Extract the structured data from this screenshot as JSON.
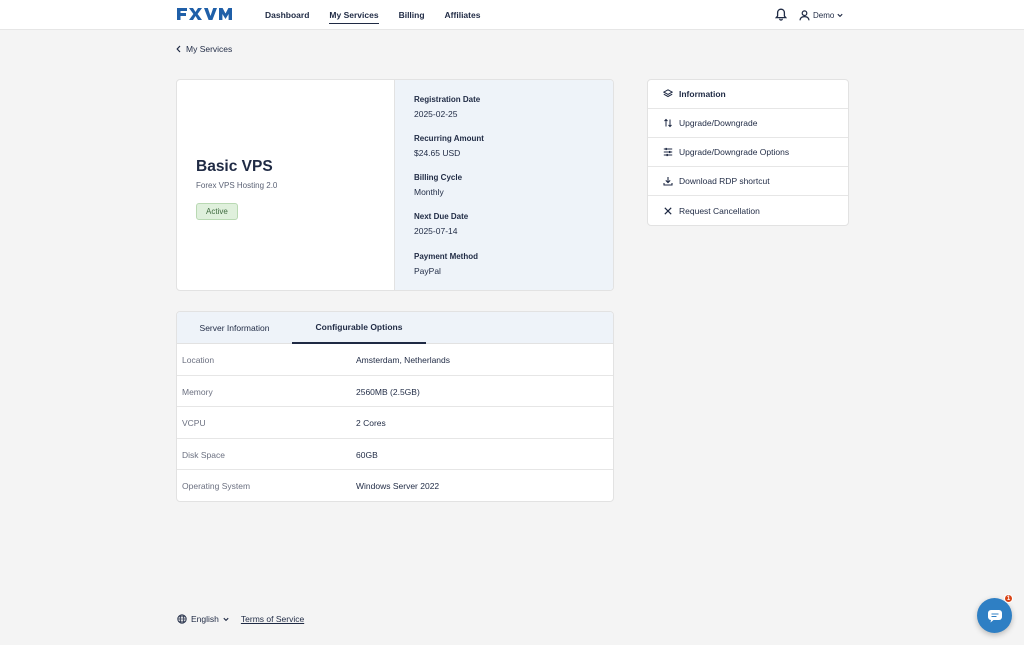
{
  "brand": {
    "logo_text": "FXVM",
    "logo_color": "#1f5fa8"
  },
  "nav": {
    "items": [
      {
        "label": "Dashboard",
        "active": false
      },
      {
        "label": "My Services",
        "active": true
      },
      {
        "label": "Billing",
        "active": false
      },
      {
        "label": "Affiliates",
        "active": false
      }
    ]
  },
  "header": {
    "notification_icon": "bell-icon",
    "user_icon": "user-icon",
    "user_name": "Demo"
  },
  "breadcrumb": {
    "back_label": "My Services"
  },
  "product": {
    "name": "Basic VPS",
    "group": "Forex VPS Hosting 2.0",
    "status": "Active",
    "status_color": "#dff0dc",
    "fields": [
      {
        "label": "Registration Date",
        "value": "2025-02-25"
      },
      {
        "label": "Recurring Amount",
        "value": "$24.65 USD"
      },
      {
        "label": "Billing Cycle",
        "value": "Monthly"
      },
      {
        "label": "Next Due Date",
        "value": "2025-07-14"
      },
      {
        "label": "Payment Method",
        "value": "PayPal"
      }
    ]
  },
  "tabs": [
    {
      "label": "Server Information",
      "active": false
    },
    {
      "label": "Configurable Options",
      "active": true
    }
  ],
  "options": [
    {
      "key": "Location",
      "value": "Amsterdam, Netherlands"
    },
    {
      "key": "Memory",
      "value": "2560MB (2.5GB)"
    },
    {
      "key": "VCPU",
      "value": "2 Cores"
    },
    {
      "key": "Disk Space",
      "value": "60GB"
    },
    {
      "key": "Operating System",
      "value": "Windows Server 2022"
    }
  ],
  "sidebar": {
    "items": [
      {
        "label": "Information",
        "icon": "layers-icon"
      },
      {
        "label": "Upgrade/Downgrade",
        "icon": "arrows-updown-icon"
      },
      {
        "label": "Upgrade/Downgrade Options",
        "icon": "sliders-icon"
      },
      {
        "label": "Download RDP shortcut",
        "icon": "download-icon"
      },
      {
        "label": "Request Cancellation",
        "icon": "close-icon"
      }
    ]
  },
  "footer": {
    "language": "English",
    "terms_label": "Terms of Service"
  },
  "chat": {
    "badge_count": "1",
    "accent": "#2e7fc4"
  }
}
